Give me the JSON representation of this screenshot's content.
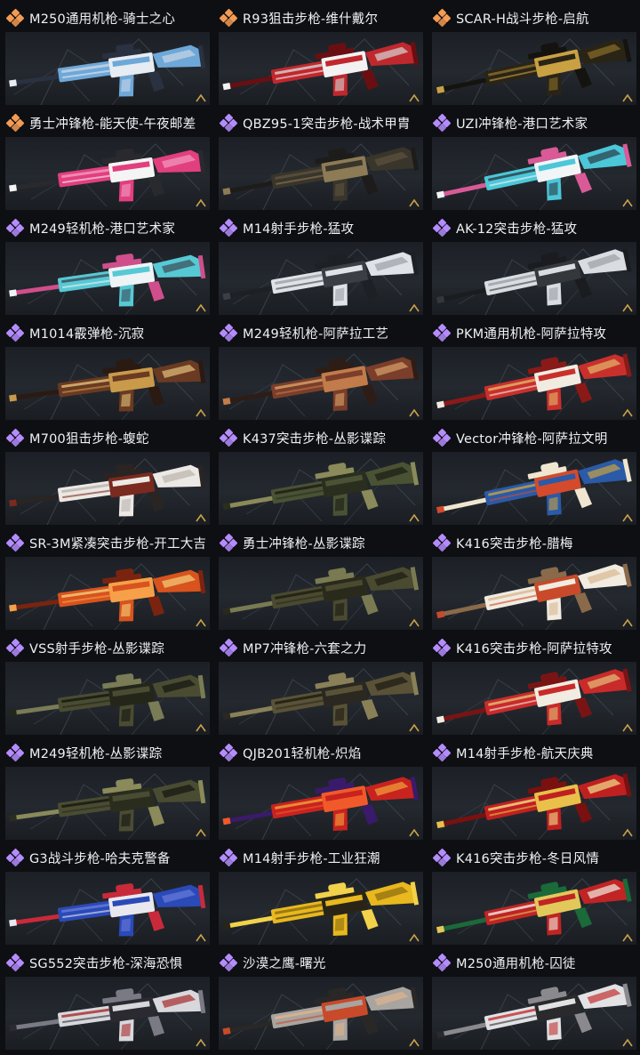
{
  "colors": {
    "purple": "#b58cff",
    "orange": "#f39a54"
  },
  "items": [
    {
      "name": "M250通用机枪-骑士之心",
      "rarity": "orange",
      "palette": [
        "#6ea8d8",
        "#e6ecf2",
        "#2a3140",
        "#c9d6e6"
      ]
    },
    {
      "name": "R93狙击步枪-维什戴尔",
      "rarity": "orange",
      "palette": [
        "#c0282d",
        "#f2f2f2",
        "#6b0e12",
        "#d4d4d4"
      ]
    },
    {
      "name": "SCAR-H战斗步枪-启航",
      "rarity": "orange",
      "palette": [
        "#2a2416",
        "#c9a143",
        "#151310",
        "#8a6e2a"
      ]
    },
    {
      "name": "勇士冲锋枪-能天使-午夜邮差",
      "rarity": "orange",
      "palette": [
        "#e23f7f",
        "#f4f4f4",
        "#2a2a2e",
        "#f29bc1"
      ]
    },
    {
      "name": "QBZ95-1突击步枪-战术甲胄",
      "rarity": "purple",
      "palette": [
        "#3a352b",
        "#8c7b55",
        "#1d1c1a",
        "#5c5340"
      ]
    },
    {
      "name": "UZI冲锋枪-港口艺术家",
      "rarity": "purple",
      "palette": [
        "#4cc7d8",
        "#f1f5f8",
        "#d95a96",
        "#2a3a44"
      ]
    },
    {
      "name": "M249轻机枪-港口艺术家",
      "rarity": "purple",
      "palette": [
        "#57c9d4",
        "#eef3f6",
        "#d04e8c",
        "#3a4a56"
      ]
    },
    {
      "name": "M14射手步枪-猛攻",
      "rarity": "purple",
      "palette": [
        "#dfe3e7",
        "#3b3f45",
        "#1d2024",
        "#9aa0a6"
      ]
    },
    {
      "name": "AK-12突击步枪-猛攻",
      "rarity": "purple",
      "palette": [
        "#d9dde2",
        "#34383d",
        "#1a1c1f",
        "#9a9fa5"
      ]
    },
    {
      "name": "M1014霰弹枪-沉寂",
      "rarity": "purple",
      "palette": [
        "#6a3a22",
        "#c99a4a",
        "#2a1a12",
        "#e2c07a"
      ]
    },
    {
      "name": "M249轻机枪-阿萨拉工艺",
      "rarity": "purple",
      "palette": [
        "#7a3e2a",
        "#c27b4a",
        "#2e1d16",
        "#d9a36a"
      ]
    },
    {
      "name": "PKM通用机枪-阿萨拉特攻",
      "rarity": "purple",
      "palette": [
        "#c9302c",
        "#f1ece2",
        "#8a1a18",
        "#e2b86a"
      ]
    },
    {
      "name": "M700狙击步枪-蝮蛇",
      "rarity": "purple",
      "palette": [
        "#ece8e4",
        "#7a2a1e",
        "#2a2422",
        "#b9b3ad"
      ]
    },
    {
      "name": "K437突击步枪-丛影谍踪",
      "rarity": "purple",
      "palette": [
        "#4a5234",
        "#2a2e1e",
        "#8a8a5a",
        "#1a1c14"
      ]
    },
    {
      "name": "Vector冲锋枪-阿萨拉文明",
      "rarity": "purple",
      "palette": [
        "#2a5aa8",
        "#d34a2c",
        "#f0e6d0",
        "#c9a143"
      ]
    },
    {
      "name": "SR-3M紧凑突击步枪-开工大吉",
      "rarity": "purple",
      "palette": [
        "#d8531e",
        "#f6a04a",
        "#7a2410",
        "#f3d07a"
      ]
    },
    {
      "name": "勇士冲锋枪-丛影谍踪",
      "rarity": "purple",
      "palette": [
        "#4a4a30",
        "#2a2a1c",
        "#7a7a52",
        "#1a1a12"
      ]
    },
    {
      "name": "K416突击步枪-腊梅",
      "rarity": "purple",
      "palette": [
        "#f1ebe0",
        "#c84a2a",
        "#8a6a4a",
        "#d8b890"
      ]
    },
    {
      "name": "VSS射手步枪-丛影谍踪",
      "rarity": "purple",
      "palette": [
        "#4a4c32",
        "#24261a",
        "#7a7c56",
        "#141510"
      ]
    },
    {
      "name": "MP7冲锋枪-六套之力",
      "rarity": "purple",
      "palette": [
        "#5a5236",
        "#2a2820",
        "#8a8058",
        "#1a1912"
      ]
    },
    {
      "name": "K416突击步枪-阿萨拉特攻",
      "rarity": "purple",
      "palette": [
        "#c92a2a",
        "#f1ece2",
        "#7a1414",
        "#e2c07a"
      ]
    },
    {
      "name": "M249轻机枪-丛影谍踪",
      "rarity": "purple",
      "palette": [
        "#4a4c32",
        "#2a2c1e",
        "#8a8a5a",
        "#141510"
      ]
    },
    {
      "name": "QJB201轻机枪-炽焰",
      "rarity": "purple",
      "palette": [
        "#c8231e",
        "#f05a2a",
        "#3a1a6a",
        "#f2a23a"
      ]
    },
    {
      "name": "M14射手步枪-航天庆典",
      "rarity": "purple",
      "palette": [
        "#c02020",
        "#e9c04a",
        "#7a1010",
        "#f2e08a"
      ]
    },
    {
      "name": "G3战斗步枪-哈夫克警备",
      "rarity": "purple",
      "palette": [
        "#2a4ab8",
        "#e8e8ee",
        "#c92a3a",
        "#6a7ad8"
      ]
    },
    {
      "name": "M14射手步枪-工业狂潮",
      "rarity": "purple",
      "palette": [
        "#e8b81e",
        "#2a2418",
        "#f2d24a",
        "#8a6a10"
      ]
    },
    {
      "name": "K416突击步枪-冬日风情",
      "rarity": "purple",
      "palette": [
        "#c02424",
        "#e2c85a",
        "#1a6a3a",
        "#f1ece2"
      ]
    },
    {
      "name": "SG552突击步枪-深海恐惧",
      "rarity": "purple",
      "palette": [
        "#d8d8dc",
        "#2a2a30",
        "#7a7a84",
        "#a82a2a"
      ]
    },
    {
      "name": "沙漠之鹰-曙光",
      "rarity": "purple",
      "palette": [
        "#a8a4a0",
        "#c84a2a",
        "#2a2826",
        "#e0b48a"
      ]
    },
    {
      "name": "M250通用机枪-囚徒",
      "rarity": "purple",
      "palette": [
        "#e2e2e4",
        "#2a2a2c",
        "#8a8a8e",
        "#c23030"
      ]
    }
  ]
}
